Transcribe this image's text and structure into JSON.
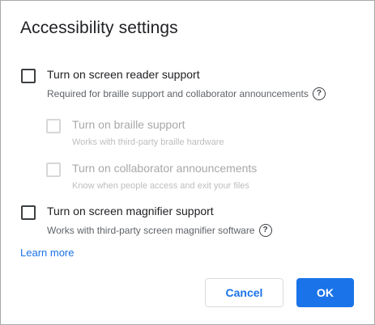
{
  "dialog": {
    "title": "Accessibility settings",
    "learn_more": "Learn more",
    "cancel_label": "Cancel",
    "ok_label": "OK"
  },
  "options": {
    "screen_reader": {
      "label": "Turn on screen reader support",
      "description": "Required for braille support and collaborator announcements",
      "checked": false,
      "enabled": true
    },
    "braille": {
      "label": "Turn on braille support",
      "description": "Works with third-party braille hardware",
      "checked": false,
      "enabled": false
    },
    "collaborator": {
      "label": "Turn on collaborator announcements",
      "description": "Know when people access and exit your files",
      "checked": false,
      "enabled": false
    },
    "magnifier": {
      "label": "Turn on screen magnifier support",
      "description": "Works with third-party screen magnifier software",
      "checked": false,
      "enabled": true
    }
  },
  "icons": {
    "help": "help-circle-icon",
    "help_glyph": "?"
  },
  "colors": {
    "accent": "#1a73e8",
    "text": "#202124",
    "disabled": "#a8a8a8"
  }
}
